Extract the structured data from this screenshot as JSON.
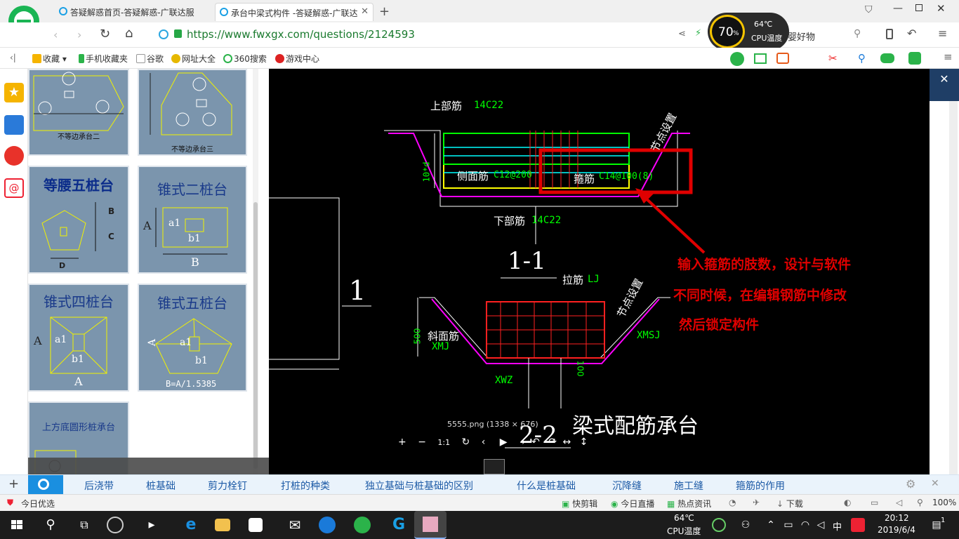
{
  "tabs": [
    {
      "title": "答疑解惑首页-答疑解惑-广联达服"
    },
    {
      "title": "承台中梁式构件 -答疑解惑-广联达"
    }
  ],
  "address": {
    "url": "https://www.fwxgx.com/questions/2124593",
    "extra": "婴好物"
  },
  "cpu_widget": {
    "percent": "70",
    "percent_unit": "%",
    "temp": "64℃",
    "label": "CPU温度"
  },
  "bookmarks": [
    {
      "label": "收藏"
    },
    {
      "label": "手机收藏夹"
    },
    {
      "label": "谷歌"
    },
    {
      "label": "网址大全"
    },
    {
      "label": "360搜索"
    },
    {
      "label": "游戏中心"
    }
  ],
  "thumbnails": {
    "top_left_caption": "不等边承台二",
    "top_right_caption": "不等边承台三",
    "mid_left_title": "等腰五桩台",
    "mid_right_title": "锥式二桩台",
    "low_left_title": "锥式四桩台",
    "low_right_title": "锥式五桩台",
    "low_right_formula": "B=A/1.5385",
    "bottom_left_title": "上方底圆形桩承台",
    "dims": {
      "a": "A",
      "b": "B",
      "c": "C",
      "d": "D",
      "a1": "a1",
      "b1": "b1"
    }
  },
  "drawing": {
    "top_rebar_label": "上部筋",
    "top_rebar_spec": "14C22",
    "side_rebar_label": "侧面筋",
    "side_rebar_spec": "C12@200",
    "stirrup_label": "箍筋",
    "stirrup_spec": "C14@100(8)",
    "bottom_rebar_label": "下部筋",
    "bottom_rebar_spec": "14C22",
    "node_setting": "节点设置",
    "section_1": "1-1",
    "section_2": "2-2",
    "marker_1": "1",
    "tie_label": "拉筋",
    "tie_spec": "LJ",
    "slope_label": "斜面筋",
    "slope_spec": "XMJ",
    "xmsj": "XMSJ",
    "xwz": "XWZ",
    "dim_500": "500",
    "dim_100": "100",
    "dim_side": "10*d",
    "title": "梁式配筋承台",
    "annotation_lines": [
      "输入箍筋的肢数，设计与软件",
      "不同时候，在编辑钢筋中修改",
      "然后锁定构件"
    ],
    "file_info": "5555.png (1338 × 676)"
  },
  "viewer_controls": [
    "+",
    "−",
    "1:1",
    "↻",
    "‹",
    "▶",
    "›",
    "↶",
    "↷",
    "↔",
    "↕"
  ],
  "tagbar": [
    "后浇带",
    "桩基础",
    "剪力栓钉",
    "打桩的种类",
    "独立基础与桩基础的区别",
    "什么是桩基础",
    "沉降缝",
    "施工缝",
    "箍筋的作用"
  ],
  "statusbar": {
    "left": "今日优选",
    "items": [
      "快剪辑",
      "今日直播",
      "热点资讯",
      "下载"
    ],
    "zoom": "100%"
  },
  "taskbar": {
    "cpu_temp": "64℃",
    "cpu_label": "CPU温度",
    "ime": "中",
    "time": "20:12",
    "date": "2019/6/4",
    "notif_count": "1"
  },
  "colors": {
    "accent": "#1aa0e5",
    "annotation_red": "#e00000",
    "cad_green": "#00ff00",
    "cad_yellow": "#ffff00",
    "cad_magenta": "#ff00ff"
  }
}
